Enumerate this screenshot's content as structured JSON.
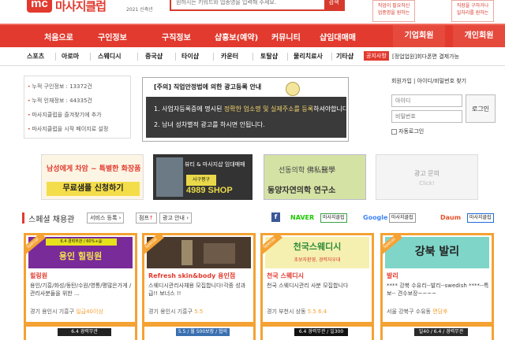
{
  "header": {
    "logo_mark": "mc",
    "logo_text": "마사지클럽",
    "logo_sub": "2021 신축년",
    "search_placeholder": "원하시는 키워드와 업종명을 입력해 주세요.",
    "search_button": "검색",
    "promo_left": [
      "직업이 필요하신",
      "업종명을 원하는"
    ],
    "promo_right": [
      "직장을 구하거나",
      "일자리를 원하는"
    ]
  },
  "nav": {
    "items": [
      "처음으로",
      "구인정보",
      "구직정보",
      "샵홍보(예약)",
      "커뮤니티",
      "샵임대매매"
    ],
    "member_corporate": "기업회원",
    "member_personal": "개인회원"
  },
  "subnav": {
    "items": [
      "스포츠",
      "아로마",
      "스웨디시",
      "중국샵",
      "타이샵",
      "카운터",
      "토탈샵",
      "물리치료사",
      "기타샵"
    ],
    "notice_badge": "공지사항",
    "notice_text": "[정업업원]회다폰면 결제가능"
  },
  "info": {
    "lines": [
      "누적 구인정보 : 13372건",
      "누적 인재정보 : 44335건",
      "마사지클럽을 즐겨찾기에 추가",
      "마사지클럽을 시작 페이지로 설정"
    ]
  },
  "center_notice": {
    "title": "[주의] 직업안정법에 의한 광고등록 안내",
    "line1_pre": "1. 사업자등록증에 명시된 ",
    "line1_hl": "정확한 업소명 및 실제주소를 등록",
    "line1_post": "하셔야합니다.",
    "line2": "2. 남녀 성차별적 광고를 하시면 안됩니다."
  },
  "login": {
    "tabs": "회원가입 | 아이디/비밀번호 찾기",
    "id_placeholder": "아이디",
    "pw_placeholder": "비밀번호",
    "button": "로그인",
    "auto": "자동로그인"
  },
  "banners": {
    "b1_pre": "남",
    "b1_red": "성",
    "b1_mid": "에게 차암 ~ 특별한 화장품",
    "b1_cta": "무료샘플 신청하기",
    "b2_top": "뷰티 & 마사지샵 임대매매",
    "b2_tag": "사구평구",
    "b2_shop": "4989 SHOP",
    "b3_top": "선동의학 佛私醫學",
    "b3_main": "동양자연의학 연구소",
    "b4_title": "광고 문의",
    "b4_sub": "Click!"
  },
  "special": {
    "title": "스페셜 채용관",
    "btn_register": "서비스 등록 ›",
    "btn_jump_pre": "점프",
    "btn_jump_red": "↑",
    "btn_guide": "광고 안내 ›",
    "naver": "NAVER",
    "naver_chip": "마사지클럽",
    "google": "Google",
    "google_chip": "마사지클럽",
    "daum": "Daum",
    "daum_chip": "마사지클럽"
  },
  "cards": [
    {
      "img_top": "6.4 경력무관 / 60%+@",
      "img_main": "용인 힐링원",
      "name": "힐링원",
      "desc": "용인/기흥/화성/동탄/수원/영통/평많은가게 /관리사분들을 위한 ...",
      "loc": "경기 용인시 기흥구",
      "loc_extra": "일급40이상"
    },
    {
      "img_top": "",
      "img_main": "",
      "name": "Refresh skin&body 용인점",
      "desc": "스웨디시관리사채용 모집합니다!각종 성과급!! 보너스 !!",
      "loc": "경기 용인시 기흥구",
      "loc_extra": "5.5"
    },
    {
      "img_top": "초보자환영, 경력자우대",
      "img_main": "천국스웨디시",
      "name": "천국 스웨디시",
      "desc": "천국 스웨디시관리 사분 모집합니다",
      "loc": "경기 부천시 상동",
      "loc_extra": "5.5 6.4"
    },
    {
      "img_top": "",
      "img_main": "강북 발리",
      "name": "발리",
      "desc": "**** 강북 수유리--발리--swedish ****--특보-- 견수보장~~~~",
      "loc": "서울 강북구 수유동",
      "loc_extra": "면담후"
    }
  ],
  "cards_row2": [
    "6.4 경력무관",
    "5.5 / 월 500보장 / 협의",
    "6.4 경력무관 / 일300",
    "일40 / 6.4 / 경력무관"
  ],
  "colors": {
    "brand": "#e23a2e",
    "card_border": "#f4a233"
  }
}
